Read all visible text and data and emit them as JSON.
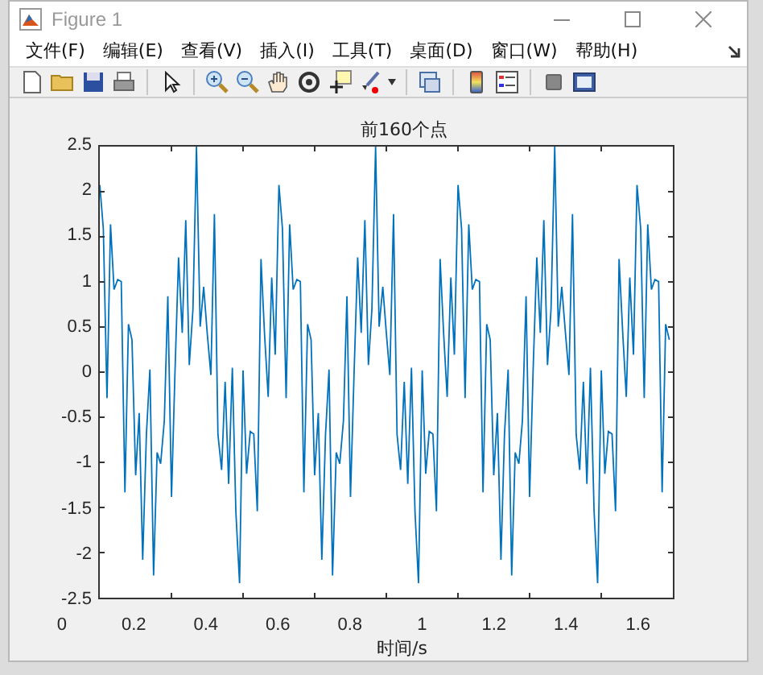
{
  "window": {
    "title": "Figure 1"
  },
  "menu": [
    {
      "label": "文件(F)"
    },
    {
      "label": "编辑(E)"
    },
    {
      "label": "查看(V)"
    },
    {
      "label": "插入(I)"
    },
    {
      "label": "工具(T)"
    },
    {
      "label": "桌面(D)"
    },
    {
      "label": "窗口(W)"
    },
    {
      "label": "帮助(H)"
    }
  ],
  "plot": {
    "title": "前160个点",
    "xlabel": "时间/s",
    "xticks": [
      "0",
      "0.2",
      "0.4",
      "0.6",
      "0.8",
      "1",
      "1.2",
      "1.4",
      "1.6"
    ],
    "yticks": [
      "2.5",
      "2",
      "1.5",
      "1",
      "0.5",
      "0",
      "-0.5",
      "-1",
      "-1.5",
      "-2",
      "-2.5"
    ]
  }
}
